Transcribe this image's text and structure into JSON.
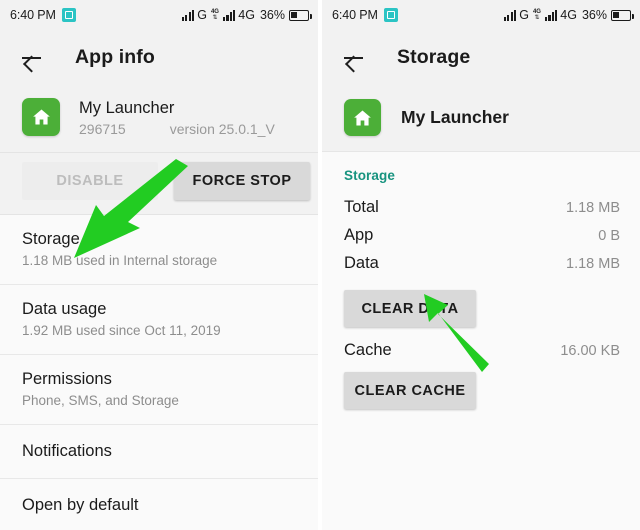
{
  "status_bar": {
    "clock": "6:40 PM",
    "capture_icon": "screenshot-capture-icon",
    "signal_label_1": "G",
    "network_mini_tag": "4G",
    "signal_label_2": "4G",
    "battery_percent": "36%",
    "battery_icon": "battery-icon"
  },
  "left_panel": {
    "appbar": {
      "back_icon": "back-arrow-icon",
      "title": "App info"
    },
    "app": {
      "icon_name": "my-launcher-app-icon",
      "name": "My Launcher",
      "package_id": "296715",
      "version": "version 25.0.1_V"
    },
    "buttons": {
      "disable": "DISABLE",
      "force_stop": "FORCE STOP"
    },
    "items": [
      {
        "title": "Storage",
        "subtitle": "1.18 MB used in Internal storage"
      },
      {
        "title": "Data usage",
        "subtitle": "1.92 MB used since Oct 11, 2019"
      },
      {
        "title": "Permissions",
        "subtitle": "Phone, SMS, and Storage"
      },
      {
        "title": "Notifications",
        "subtitle": ""
      },
      {
        "title": "Open by default",
        "subtitle": ""
      }
    ]
  },
  "right_panel": {
    "appbar": {
      "back_icon": "back-arrow-icon",
      "title": "Storage"
    },
    "app": {
      "icon_name": "my-launcher-app-icon",
      "name": "My Launcher"
    },
    "section_label": "Storage",
    "rows": [
      {
        "key": "Total",
        "value": "1.18 MB"
      },
      {
        "key": "App",
        "value": "0 B"
      },
      {
        "key": "Data",
        "value": "1.18 MB"
      }
    ],
    "clear_data_button": "CLEAR DATA",
    "cache": {
      "key": "Cache",
      "value": "16.00 KB"
    },
    "clear_cache_button": "CLEAR CACHE"
  },
  "annotations": {
    "arrow_left_name": "green-arrow-pointing-to-storage",
    "arrow_right_name": "green-arrow-pointing-to-clear-data",
    "arrow_color": "#22cc22"
  },
  "colors": {
    "accent_teal": "#17937f",
    "app_icon_green": "#4caf38",
    "arrow_green": "#22cc22"
  }
}
